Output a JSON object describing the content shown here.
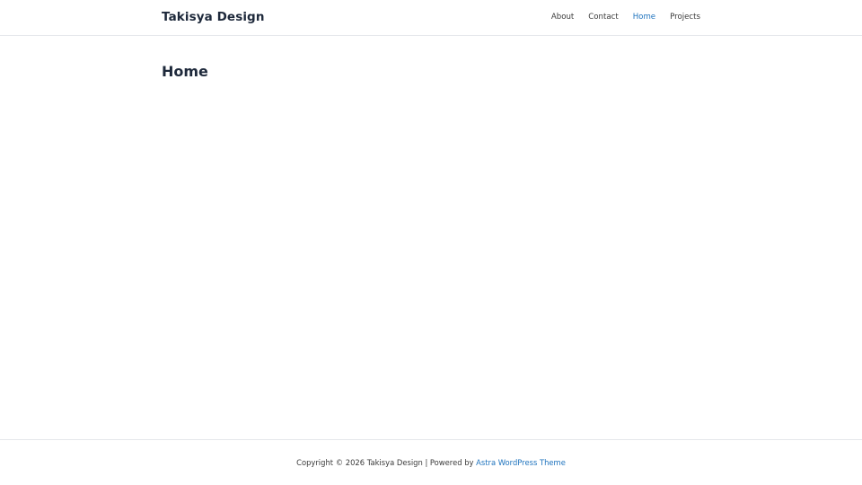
{
  "header": {
    "site_title": "Takisya Design",
    "nav": [
      {
        "label": "About",
        "active": false
      },
      {
        "label": "Contact",
        "active": false
      },
      {
        "label": "Home",
        "active": true
      },
      {
        "label": "Projects",
        "active": false
      }
    ]
  },
  "main": {
    "page_title": "Home"
  },
  "footer": {
    "copyright_prefix": "Copyright © 2026 Takisya Design | Powered by ",
    "theme_link": "Astra WordPress Theme"
  },
  "colors": {
    "accent": "#1e73be",
    "text": "#3a3a3a",
    "heading": "#1e293b",
    "divider": "#e5e7eb"
  }
}
